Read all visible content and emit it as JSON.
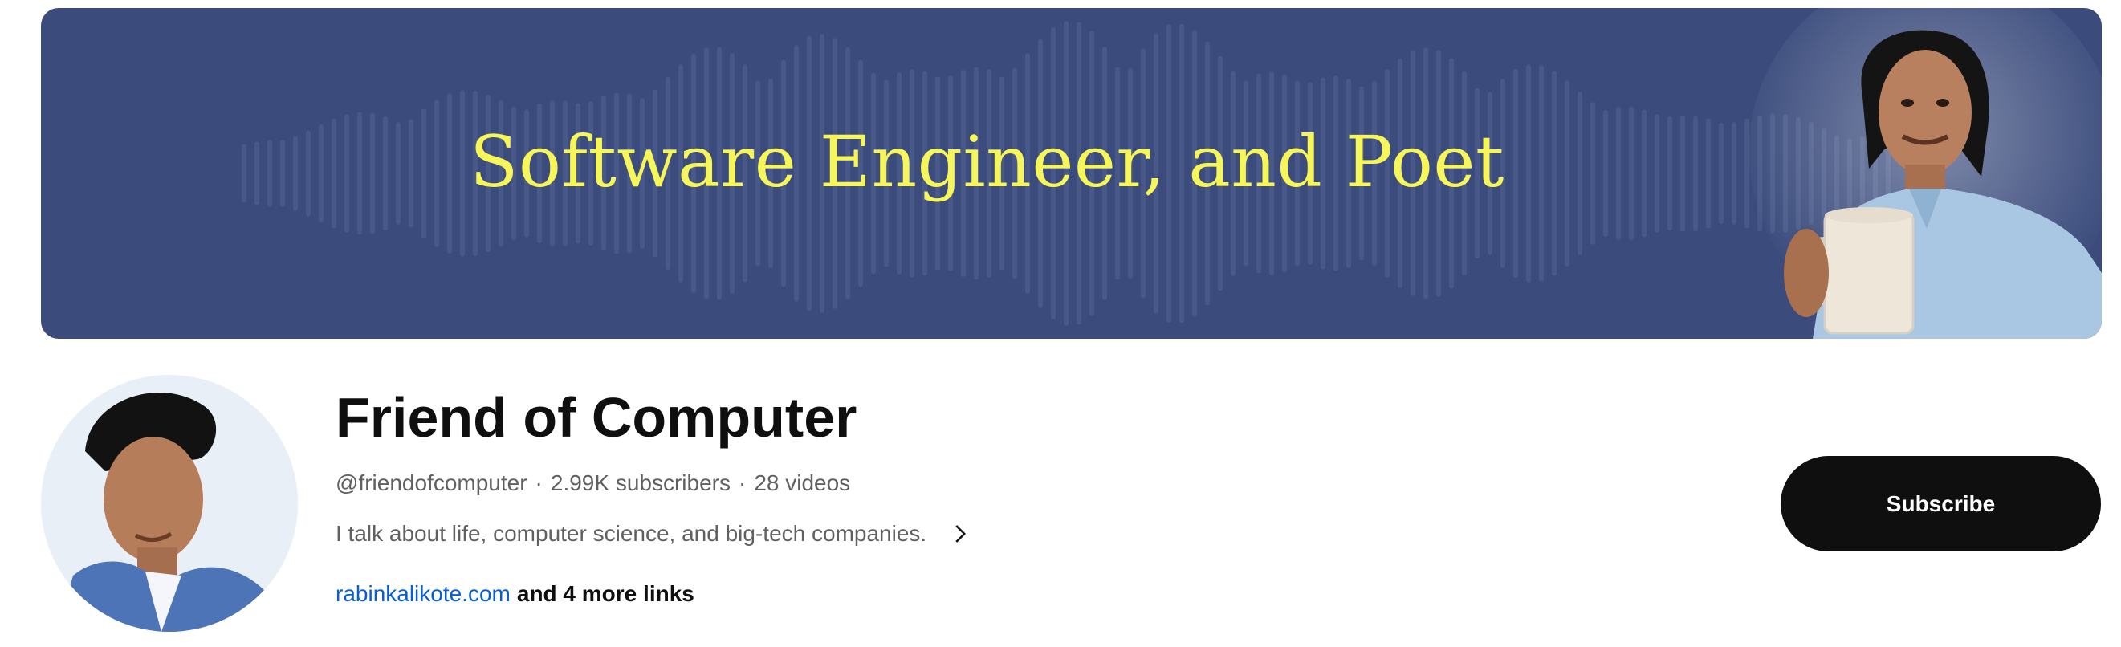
{
  "banner": {
    "title": "Software Engineer, and Poet",
    "background_color": "#3a4b7c",
    "title_color": "#f6f55a"
  },
  "channel": {
    "name": "Friend of Computer",
    "handle": "@friendofcomputer",
    "subscribers": "2.99K subscribers",
    "videos": "28 videos",
    "separator": "·",
    "description": "I talk about life, computer science, and big-tech companies.",
    "description_expand_icon": "chevron-right-icon",
    "link": "rabinkalikote.com",
    "more_links": "and 4 more links"
  },
  "subscribe": {
    "label": "Subscribe",
    "background_color": "#0f0f0f"
  },
  "colors": {
    "link": "#065fd4",
    "meta_text": "#606060"
  }
}
